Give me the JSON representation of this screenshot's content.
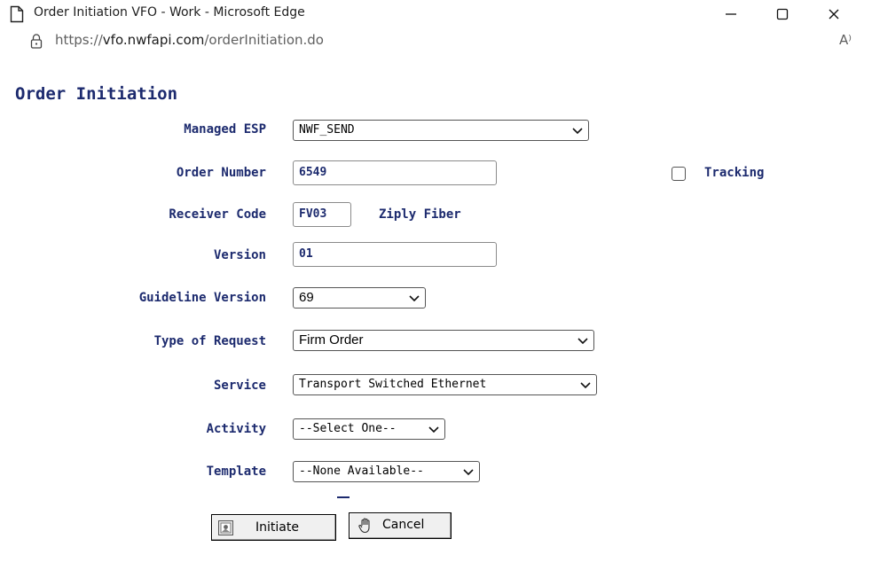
{
  "window": {
    "title": "Order Initiation VFO - Work - Microsoft Edge",
    "url_prefix": "https://",
    "url_host": "vfo.nwfapi.com",
    "url_path": "/orderInitiation.do",
    "read_aloud_glyph": "A⁾"
  },
  "page": {
    "title": "Order Initiation"
  },
  "form": {
    "managed_esp": {
      "label": "Managed ESP",
      "value": "NWF_SEND"
    },
    "order_number": {
      "label": "Order Number",
      "value": "6549"
    },
    "tracking": {
      "label": "Tracking",
      "checked": false
    },
    "receiver_code": {
      "label": "Receiver Code",
      "value": "FV03",
      "name": "Ziply Fiber"
    },
    "version": {
      "label": "Version",
      "value": "01"
    },
    "guideline_version": {
      "label": "Guideline Version",
      "value": "69"
    },
    "type_of_request": {
      "label": "Type of Request",
      "value": "Firm Order"
    },
    "service": {
      "label": "Service",
      "value": "Transport Switched Ethernet"
    },
    "activity": {
      "label": "Activity",
      "value": "--Select One--"
    },
    "template": {
      "label": "Template",
      "value": "--None Available--"
    }
  },
  "buttons": {
    "initiate": "Initiate",
    "cancel": "Cancel"
  },
  "colors": {
    "label_navy": "#1c2a6e",
    "button_face": "#f0f0f0"
  }
}
